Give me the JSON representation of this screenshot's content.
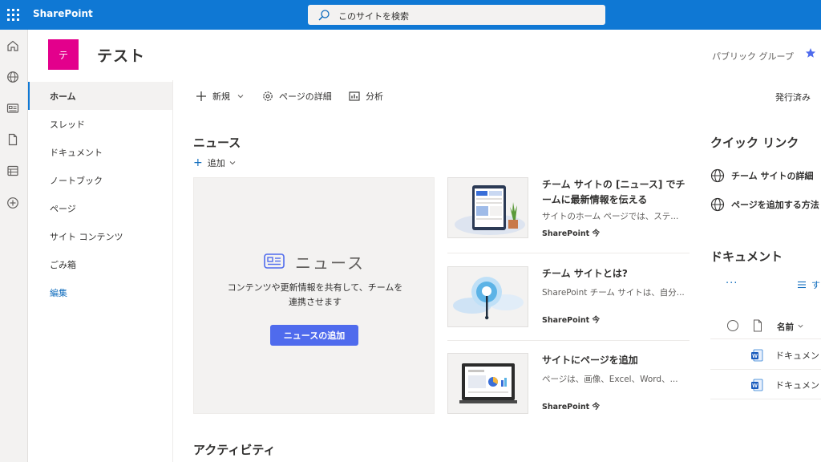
{
  "suitebar": {
    "brand": "SharePoint",
    "search_placeholder": "このサイトを検索",
    "icons": [
      "app-launcher-icon",
      "search-icon"
    ]
  },
  "rail": {
    "icons": [
      "home-icon",
      "globe-icon",
      "news-icon",
      "file-icon",
      "list-icon",
      "add-circle-icon"
    ]
  },
  "site": {
    "logo_letter": "テ",
    "title": "テスト",
    "group_type": "パブリック グループ",
    "logo_color": "#e3008c"
  },
  "nav": {
    "items": [
      {
        "label": "ホーム",
        "active": true
      },
      {
        "label": "スレッド"
      },
      {
        "label": "ドキュメント"
      },
      {
        "label": "ノートブック"
      },
      {
        "label": "ページ"
      },
      {
        "label": "サイト コンテンツ"
      },
      {
        "label": "ごみ箱"
      }
    ],
    "edit": "編集"
  },
  "command": {
    "new": "新規",
    "page_details": "ページの詳細",
    "analytics": "分析",
    "status": "発行済み"
  },
  "news": {
    "heading": "ニュース",
    "add": "追加",
    "empty_title": "ニュース",
    "empty_desc": "コンテンツや更新情報を共有して、チームを連携させます",
    "add_news_button": "ニュースの追加",
    "cards": [
      {
        "title": "チーム サイトの [ニュース] でチームに最新情報を伝える",
        "desc": "サイトのホーム ページでは、ステ...",
        "source": "SharePoint",
        "time": "今"
      },
      {
        "title": "チーム サイトとは?",
        "desc": "SharePoint チーム サイトは、自分...",
        "source": "SharePoint",
        "time": "今"
      },
      {
        "title": "サイトにページを追加",
        "desc": "ページは、画像、Excel、Word、...",
        "source": "SharePoint",
        "time": "今"
      }
    ]
  },
  "activity": {
    "heading": "アクティビティ"
  },
  "quicklinks": {
    "heading": "クイック リンク",
    "items": [
      {
        "label": "チーム サイトの詳細"
      },
      {
        "label": "ページを追加する方法"
      }
    ]
  },
  "documents": {
    "heading": "ドキュメント",
    "more": "···",
    "view_label": "す",
    "column_name": "名前",
    "files": [
      {
        "name": "ドキュメン"
      },
      {
        "name": "ドキュメン"
      }
    ]
  },
  "colors": {
    "suitebar": "#0f78d4",
    "accent_button": "#4f6bed",
    "link": "#0f6cbd"
  }
}
